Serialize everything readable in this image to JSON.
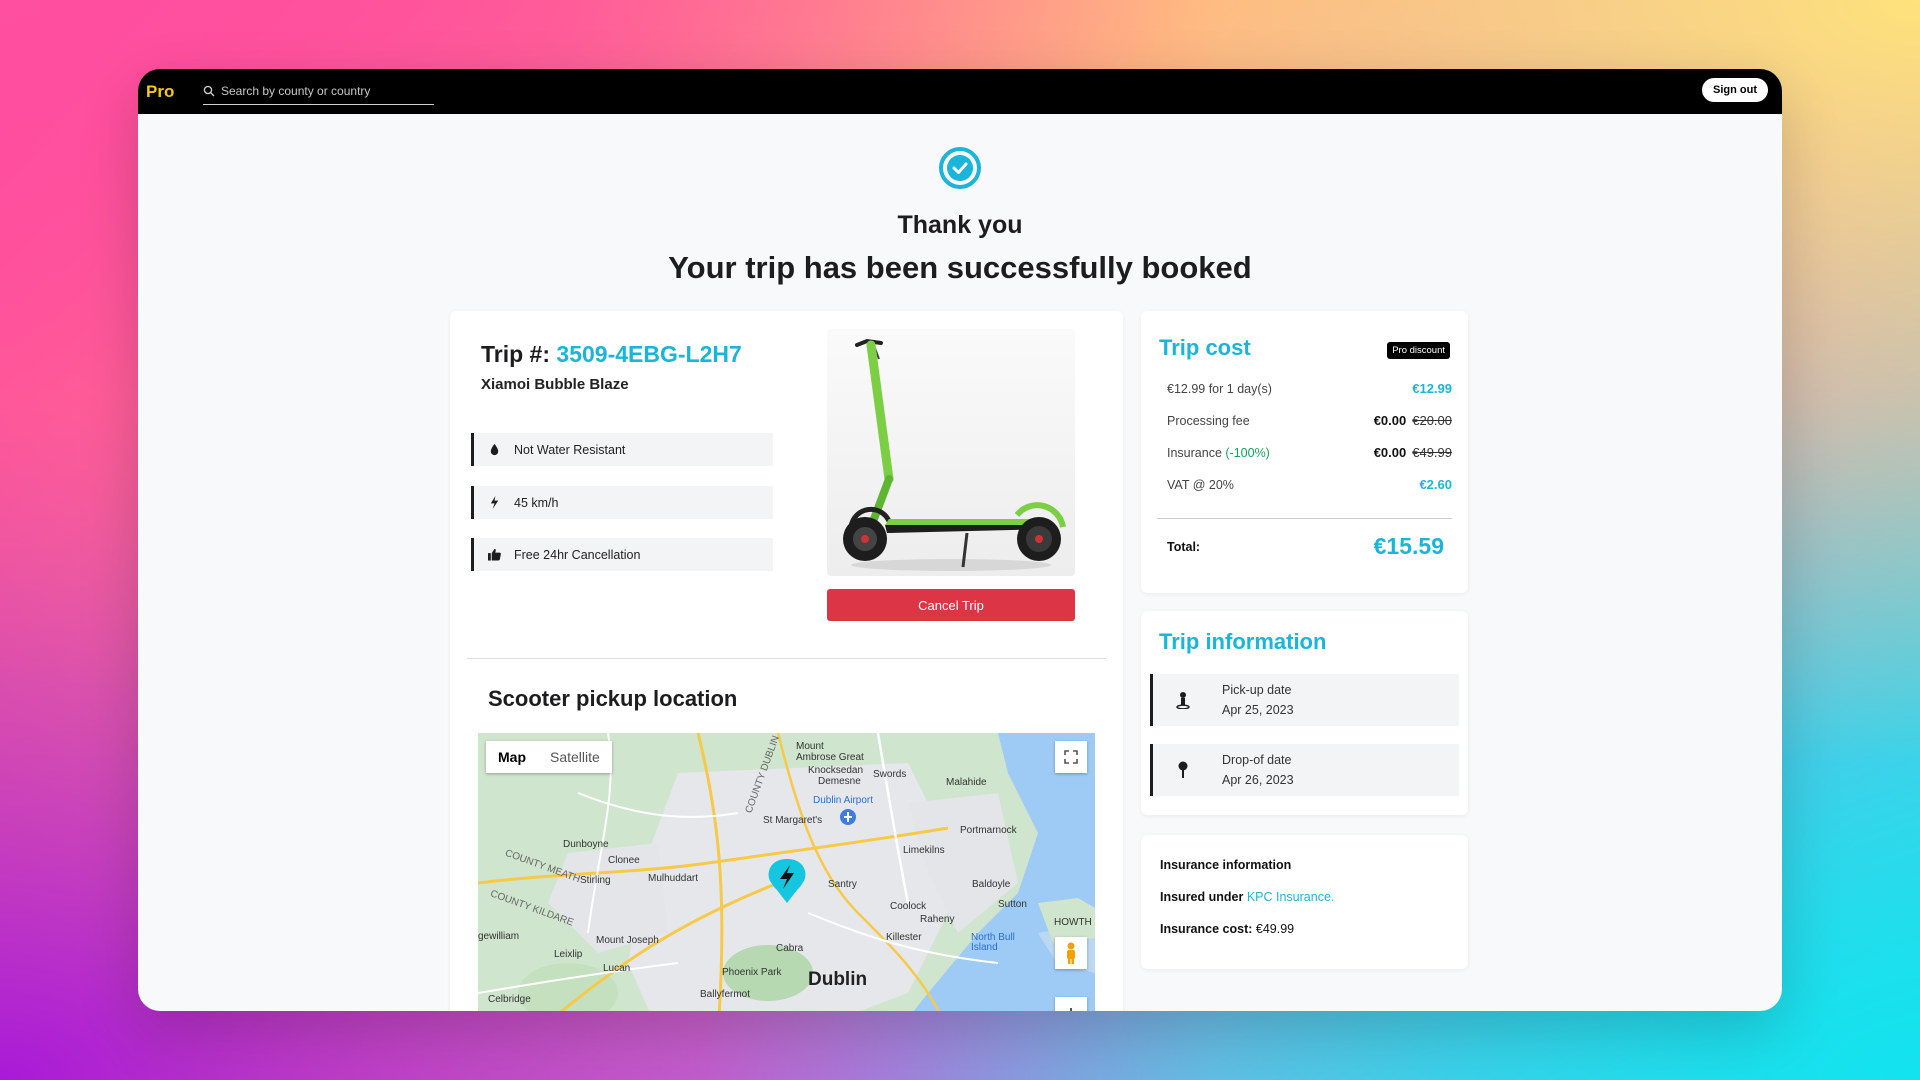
{
  "topbar": {
    "brand": "Pro",
    "search_placeholder": "Search by county or country",
    "signout_label": "Sign out"
  },
  "hero": {
    "thanks": "Thank you",
    "headline": "Your trip has been successfully booked"
  },
  "trip": {
    "label": "Trip #:",
    "number": "3509-4EBG-L2H7",
    "model": "Xiamoi Bubble Blaze",
    "features": [
      {
        "icon": "droplet-icon",
        "label": "Not Water Resistant"
      },
      {
        "icon": "lightning-icon",
        "label": "45 km/h"
      },
      {
        "icon": "thumbs-up-icon",
        "label": "Free 24hr Cancellation"
      }
    ],
    "cancel_label": "Cancel Trip"
  },
  "pickup": {
    "title": "Scooter pickup location",
    "map_tab": "Map",
    "satellite_tab": "Satellite",
    "map_labels": [
      "Mount Ambrose Great",
      "Knocksedan",
      "Demesne",
      "Swords",
      "Malahide",
      "Dublin Airport",
      "St Margaret's",
      "Portmarnock",
      "Dunboyne",
      "Clonee",
      "Limekilns",
      "Mulhuddart",
      "Santry",
      "Baldoyle",
      "Sutton",
      "Coolock",
      "Raheny",
      "Killester",
      "HOWTH",
      "North Bull Island",
      "Mount Joseph",
      "Lucan",
      "Leixlip",
      "Cabra",
      "Phoenix Park",
      "Dublin",
      "Ballyfermot",
      "Celbridge",
      "gewilliam",
      "COUNTY MEATH",
      "COUNTY KILDARE",
      "COUNTY DUBLIN",
      "Stirling"
    ]
  },
  "cost": {
    "title": "Trip cost",
    "badge": "Pro discount",
    "rows": [
      {
        "label": "€12.99 for 1 day(s)",
        "value": "€12.99",
        "old": ""
      },
      {
        "label": "Processing fee",
        "value": "€0.00",
        "old": "€20.00"
      },
      {
        "label": "Insurance",
        "label_extra": "(-100%)",
        "value": "€0.00",
        "old": "€49.99"
      },
      {
        "label": "VAT @ 20%",
        "value": "€2.60",
        "old": ""
      }
    ],
    "total_label": "Total:",
    "total_value": "€15.59"
  },
  "info": {
    "title": "Trip information",
    "pickup_label": "Pick-up date",
    "pickup_date": "Apr 25, 2023",
    "dropoff_label": "Drop-of date",
    "dropoff_date": "Apr 26, 2023"
  },
  "insurance": {
    "title": "Insurance information",
    "insured_label": "Insured under",
    "insurer": "KPC Insurance.",
    "cost_label": "Insurance cost:",
    "cost_value": "€49.99"
  },
  "colors": {
    "accent": "#1bb5d9",
    "danger": "#dc3545",
    "brand": "#f4c91c"
  }
}
